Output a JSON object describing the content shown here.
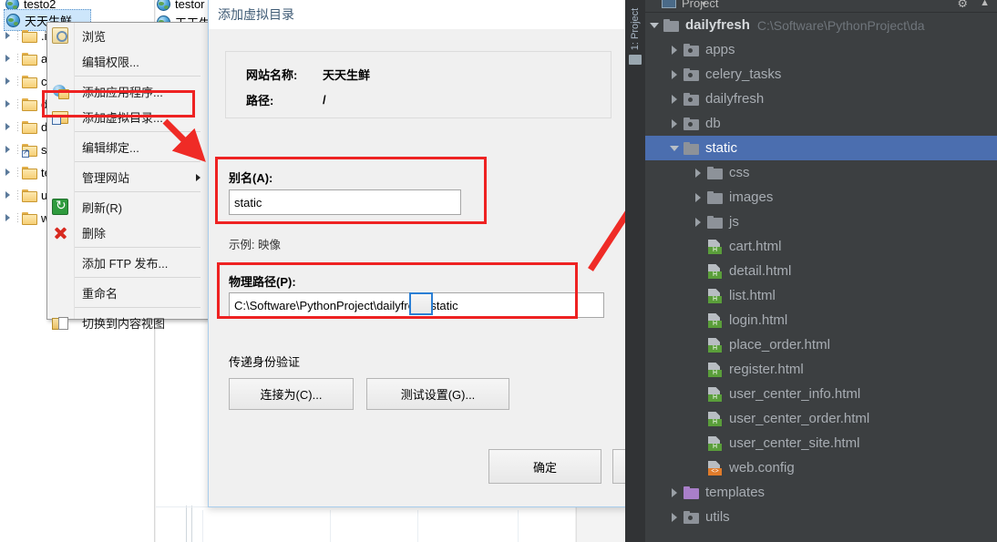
{
  "iis": {
    "tree": {
      "top_sites": [
        {
          "label": "testo2",
          "icon": "globe-icon",
          "selected": false
        },
        {
          "label": "天天生鲜",
          "icon": "globe-icon",
          "selected": true
        }
      ],
      "children": [
        {
          "label": ".id",
          "icon": "folder-icon",
          "shortcut": false
        },
        {
          "label": "ap",
          "icon": "folder-icon",
          "shortcut": false
        },
        {
          "label": "ce",
          "icon": "folder-icon",
          "shortcut": false
        },
        {
          "label": "d",
          "icon": "folder-icon",
          "shortcut": false
        },
        {
          "label": "d",
          "icon": "folder-icon",
          "shortcut": false
        },
        {
          "label": "st",
          "icon": "folder-shortcut-icon",
          "shortcut": true
        },
        {
          "label": "te",
          "icon": "folder-icon",
          "shortcut": false
        },
        {
          "label": "ut",
          "icon": "folder-icon",
          "shortcut": false
        },
        {
          "label": "w",
          "icon": "folder-icon",
          "shortcut": false
        }
      ],
      "second_column_sites": [
        {
          "label": "testor",
          "icon": "globe-icon"
        },
        {
          "label": "天天生",
          "icon": "globe-icon"
        }
      ]
    },
    "context_menu": {
      "items": [
        {
          "label": "浏览",
          "icon": "browse-icon",
          "highlighted": false,
          "separator_after": false,
          "submenu": false
        },
        {
          "label": "编辑权限...",
          "icon": "none",
          "highlighted": false,
          "separator_after": true,
          "submenu": false
        },
        {
          "label": "添加应用程序...",
          "icon": "add-application-icon",
          "highlighted": false,
          "separator_after": false,
          "submenu": false
        },
        {
          "label": "添加虚拟目录...",
          "icon": "add-virtual-directory-icon",
          "highlighted": true,
          "separator_after": true,
          "submenu": false
        },
        {
          "label": "编辑绑定...",
          "icon": "none",
          "highlighted": false,
          "separator_after": true,
          "submenu": false
        },
        {
          "label": "管理网站",
          "icon": "none",
          "highlighted": false,
          "separator_after": true,
          "submenu": true
        },
        {
          "label": "刷新(R)",
          "icon": "refresh-icon",
          "highlighted": false,
          "separator_after": false,
          "submenu": false
        },
        {
          "label": "删除",
          "icon": "delete-icon",
          "highlighted": false,
          "separator_after": true,
          "submenu": false
        },
        {
          "label": "添加 FTP 发布...",
          "icon": "none",
          "highlighted": false,
          "separator_after": true,
          "submenu": false
        },
        {
          "label": "重命名",
          "icon": "none",
          "highlighted": false,
          "separator_after": true,
          "submenu": false
        },
        {
          "label": "切换到内容视图",
          "icon": "switch-to-content-view-icon",
          "highlighted": false,
          "separator_after": false,
          "submenu": false
        }
      ]
    }
  },
  "dialog": {
    "title": "添加虚拟目录",
    "site_name_label": "网站名称:",
    "site_name_value": "天天生鲜",
    "path_label": "路径:",
    "path_value": "/",
    "alias_label": "别名(A):",
    "alias_value": "static",
    "alias_hint": "示例: 映像",
    "physical_path_label": "物理路径(P):",
    "physical_path_value": "C:\\Software\\PythonProject\\dailyfresh\\static",
    "browse_button_label": "...",
    "passthrough_label": "传递身份验证",
    "connect_as_button": "连接为(C)...",
    "test_settings_button": "测试设置(G)...",
    "ok_button": "确定",
    "cancel_button": ""
  },
  "annotations": {
    "highlight_color": "#ee2222",
    "arrow_color": "#ef2b26",
    "boxes": [
      {
        "name": "menu-add-virtual-directory"
      },
      {
        "name": "alias-field"
      },
      {
        "name": "physical-path-field"
      }
    ],
    "arrows": [
      {
        "name": "menu-pointer-arrow"
      },
      {
        "name": "path-to-static-arrow"
      }
    ]
  },
  "pycharm": {
    "sidebar_label": "1: Project",
    "panel_title": "Project",
    "root": {
      "name": "dailyfresh",
      "path": "C:\\Software\\PythonProject\\da",
      "expanded": true
    },
    "tree": [
      {
        "label": "apps",
        "kind": "module-folder",
        "state": "closed",
        "indent": 1,
        "selected": false
      },
      {
        "label": "celery_tasks",
        "kind": "module-folder",
        "state": "closed",
        "indent": 1,
        "selected": false
      },
      {
        "label": "dailyfresh",
        "kind": "module-folder",
        "state": "closed",
        "indent": 1,
        "selected": false
      },
      {
        "label": "db",
        "kind": "module-folder",
        "state": "closed",
        "indent": 1,
        "selected": false
      },
      {
        "label": "static",
        "kind": "folder",
        "state": "open",
        "indent": 1,
        "selected": true
      },
      {
        "label": "css",
        "kind": "folder",
        "state": "closed",
        "indent": 2,
        "selected": false
      },
      {
        "label": "images",
        "kind": "folder",
        "state": "closed",
        "indent": 2,
        "selected": false
      },
      {
        "label": "js",
        "kind": "folder",
        "state": "closed",
        "indent": 2,
        "selected": false
      },
      {
        "label": "cart.html",
        "kind": "html-file",
        "badge": "H",
        "state": "none",
        "indent": 2,
        "selected": false
      },
      {
        "label": "detail.html",
        "kind": "html-file",
        "badge": "H",
        "state": "none",
        "indent": 2,
        "selected": false
      },
      {
        "label": "list.html",
        "kind": "html-file",
        "badge": "H",
        "state": "none",
        "indent": 2,
        "selected": false
      },
      {
        "label": "login.html",
        "kind": "html-file",
        "badge": "H",
        "state": "none",
        "indent": 2,
        "selected": false
      },
      {
        "label": "place_order.html",
        "kind": "html-file",
        "badge": "H",
        "state": "none",
        "indent": 2,
        "selected": false
      },
      {
        "label": "register.html",
        "kind": "html-file",
        "badge": "H",
        "state": "none",
        "indent": 2,
        "selected": false
      },
      {
        "label": "user_center_info.html",
        "kind": "html-file",
        "badge": "H",
        "state": "none",
        "indent": 2,
        "selected": false
      },
      {
        "label": "user_center_order.html",
        "kind": "html-file",
        "badge": "H",
        "state": "none",
        "indent": 2,
        "selected": false
      },
      {
        "label": "user_center_site.html",
        "kind": "html-file",
        "badge": "H",
        "state": "none",
        "indent": 2,
        "selected": false
      },
      {
        "label": "web.config",
        "kind": "config-file",
        "badge": "<>",
        "state": "none",
        "indent": 2,
        "selected": false
      },
      {
        "label": "templates",
        "kind": "template-folder",
        "state": "closed",
        "indent": 1,
        "selected": false
      },
      {
        "label": "utils",
        "kind": "module-folder",
        "state": "closed",
        "indent": 1,
        "selected": false
      }
    ],
    "colors": {
      "background": "#3c3f41",
      "selection": "#4b6eaf",
      "text": "#a8adb3",
      "path_text": "#6f757b",
      "html_badge": "#5a9e3a",
      "config_badge": "#e07b2a",
      "template_folder": "#a97fc9"
    }
  }
}
